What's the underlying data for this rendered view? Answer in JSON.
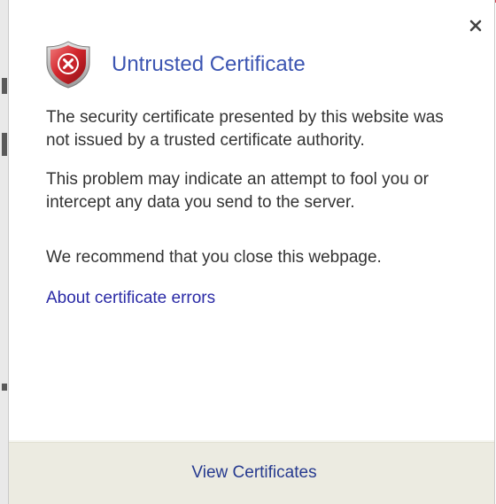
{
  "dialog": {
    "title": "Untrusted Certificate",
    "close_label": "x",
    "paragraphs": [
      "The security certificate presented by this website was not issued by a trusted certificate authority.",
      "This problem may indicate an attempt to fool you or intercept any data you send to the server.",
      "We recommend that you close this webpage."
    ],
    "link_label": "About certificate errors",
    "footer_button_label": "View Certificates",
    "icon": "shield-error-icon"
  },
  "colors": {
    "title": "#3c55b2",
    "link": "#2a2aa6",
    "footer_bg": "#ecebe1",
    "shield_red": "#c8242b"
  }
}
